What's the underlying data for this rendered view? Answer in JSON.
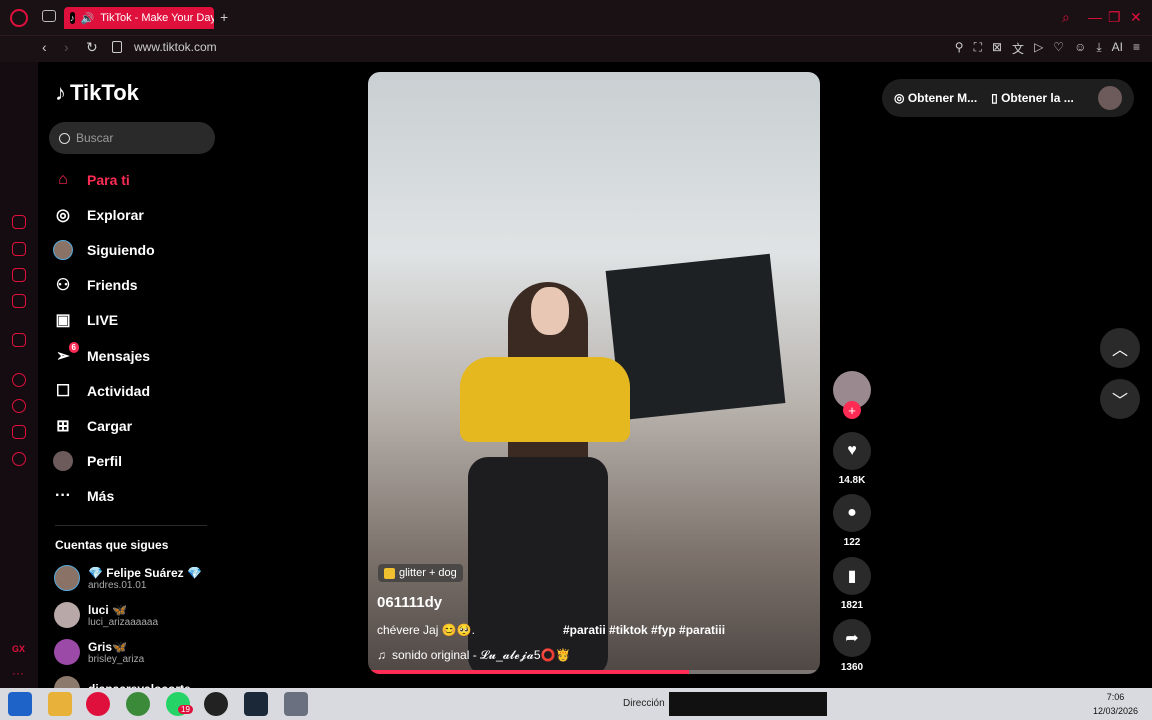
{
  "browser": {
    "tab_title": "TikTok - Make Your Day",
    "url": "www.tiktok.com",
    "ai_label": "AI"
  },
  "tiktok": {
    "logo": "TikTok",
    "search_placeholder": "Buscar",
    "nav": [
      {
        "label": "Para ti",
        "icon": "home-icon",
        "active": true
      },
      {
        "label": "Explorar",
        "icon": "compass-icon"
      },
      {
        "label": "Siguiendo",
        "icon": "following-avatar-icon"
      },
      {
        "label": "Friends",
        "icon": "friends-icon"
      },
      {
        "label": "LIVE",
        "icon": "live-icon"
      },
      {
        "label": "Mensajes",
        "icon": "messages-icon",
        "badge": "6"
      },
      {
        "label": "Actividad",
        "icon": "activity-icon"
      },
      {
        "label": "Cargar",
        "icon": "upload-icon"
      },
      {
        "label": "Perfil",
        "icon": "profile-icon"
      },
      {
        "label": "Más",
        "icon": "more-icon"
      }
    ],
    "following_title": "Cuentas que sigues",
    "following": [
      {
        "name": "💎 Felipe Suárez 💎",
        "username": "andres.01.01"
      },
      {
        "name": "luci 🦋",
        "username": "luci_arizaaaaaa"
      },
      {
        "name": "Gris🦋",
        "username": "brisley_ariza"
      },
      {
        "name": "dianaarevalocorte",
        "username": ""
      }
    ],
    "video": {
      "effect": "glitter + dog",
      "username": "061111dy",
      "caption": "chévere Jaj 😊🥺.",
      "hashtags": "#paratii #tiktok #fyp #paratiii",
      "sound": "sonido original - 𝓛𝓾_𝓪𝓵𝓮𝓳𝓪5⭕🫅",
      "progress": 0.71
    },
    "actions": {
      "likes": "14.8K",
      "comments": "122",
      "saves": "1821",
      "shares": "1360"
    },
    "top_right": {
      "get_coins": "Obtener M...",
      "get_app": "Obtener la ..."
    }
  },
  "taskbar": {
    "direccion": "Dirección",
    "whatsapp_badge": "19",
    "time": "7:06",
    "date": "12/03/2026"
  },
  "colors": {
    "accent": "#fe2c55",
    "opera": "#e0103c"
  }
}
